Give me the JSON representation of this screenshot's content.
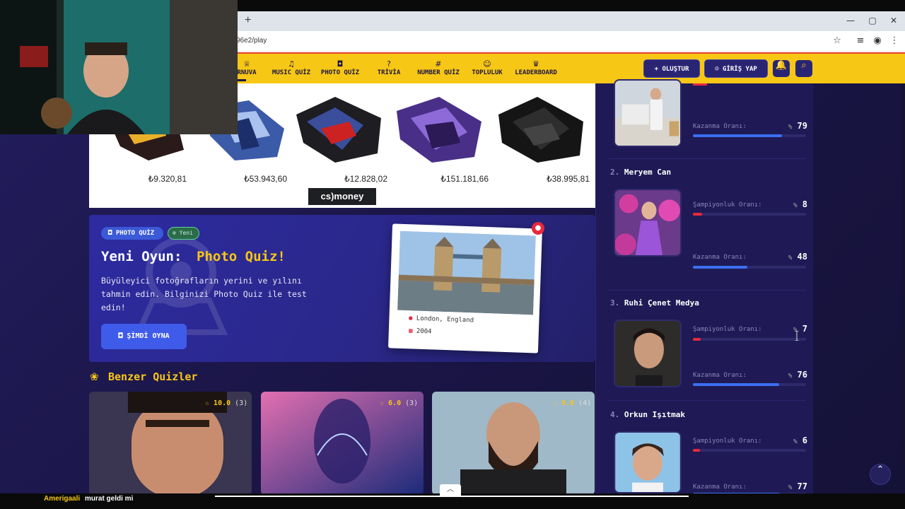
{
  "browser": {
    "new_tab": "+",
    "url": "96e2/play",
    "window_controls": [
      "—",
      "▢",
      "✕"
    ]
  },
  "nav": {
    "items": [
      {
        "icon": "trophy-icon",
        "glyph": "♕",
        "label": "RNUVA"
      },
      {
        "icon": "music-icon",
        "glyph": "♫",
        "label": "MUSIC QUİZ"
      },
      {
        "icon": "camera-icon",
        "glyph": "◘",
        "label": "PHOTO QUİZ"
      },
      {
        "icon": "question-icon",
        "glyph": "?",
        "label": "TRİVİA"
      },
      {
        "icon": "hash-icon",
        "glyph": "#",
        "label": "NUMBER QUİZ"
      },
      {
        "icon": "users-icon",
        "glyph": "☺",
        "label": "TOPLULUK"
      },
      {
        "icon": "trophy-icon",
        "glyph": "♛",
        "label": "LEADERBOARD"
      }
    ],
    "create_label": "+ OLUŞTUR",
    "login_label": "GİRİŞ YAP",
    "bell_glyph": "🔔",
    "search_glyph": "⌕",
    "accent": "#f7c715"
  },
  "ad": {
    "prices": [
      "₺9.320,81",
      "₺53.943,60",
      "₺12.828,02",
      "₺151.181,66",
      "₺38.995,81"
    ],
    "brand": "cs)money"
  },
  "promo": {
    "badge_category": "PHOTO QUİZ",
    "badge_new": "Yeni",
    "title_prefix": "Yeni Oyun:",
    "title_highlight": "Photo Quiz!",
    "description": "Büyüleyici fotoğrafların yerini ve yılını tahmin edin. Bilginizi Photo Quiz ile test edin!",
    "play_label": "ŞİMDİ OYNA",
    "photo_location": "London, England",
    "photo_year": "2004"
  },
  "similar": {
    "title": "Benzer Quizler",
    "cards": [
      {
        "rating": "10.0",
        "count": "(3)"
      },
      {
        "rating": "6.0",
        "count": "(3)"
      },
      {
        "rating": "9.8",
        "count": "(4)"
      }
    ]
  },
  "leaderboard": {
    "champ_label": "Şampiyonluk Oranı:",
    "win_label": "Kazanma Oranı:",
    "percent_sign": "%",
    "top_entry": {
      "win_rate": "79",
      "win_fill": 0.79
    },
    "entries": [
      {
        "rank": "2.",
        "name": "Meryem Can",
        "champ": "8",
        "champ_fill": 0.08,
        "win": "48",
        "win_fill": 0.48
      },
      {
        "rank": "3.",
        "name": "Ruhi Çenet Medya",
        "champ": "7",
        "champ_fill": 0.07,
        "win": "76",
        "win_fill": 0.76
      },
      {
        "rank": "4.",
        "name": "Orkun Işıtmak",
        "champ": "6",
        "champ_fill": 0.06,
        "win": "77",
        "win_fill": 0.77
      }
    ],
    "champ_color": "#e8283c",
    "win_color": "#3b6ff2"
  },
  "stream": {
    "chat_user": "Amerigaali",
    "chat_message": "murat geldi mi"
  }
}
